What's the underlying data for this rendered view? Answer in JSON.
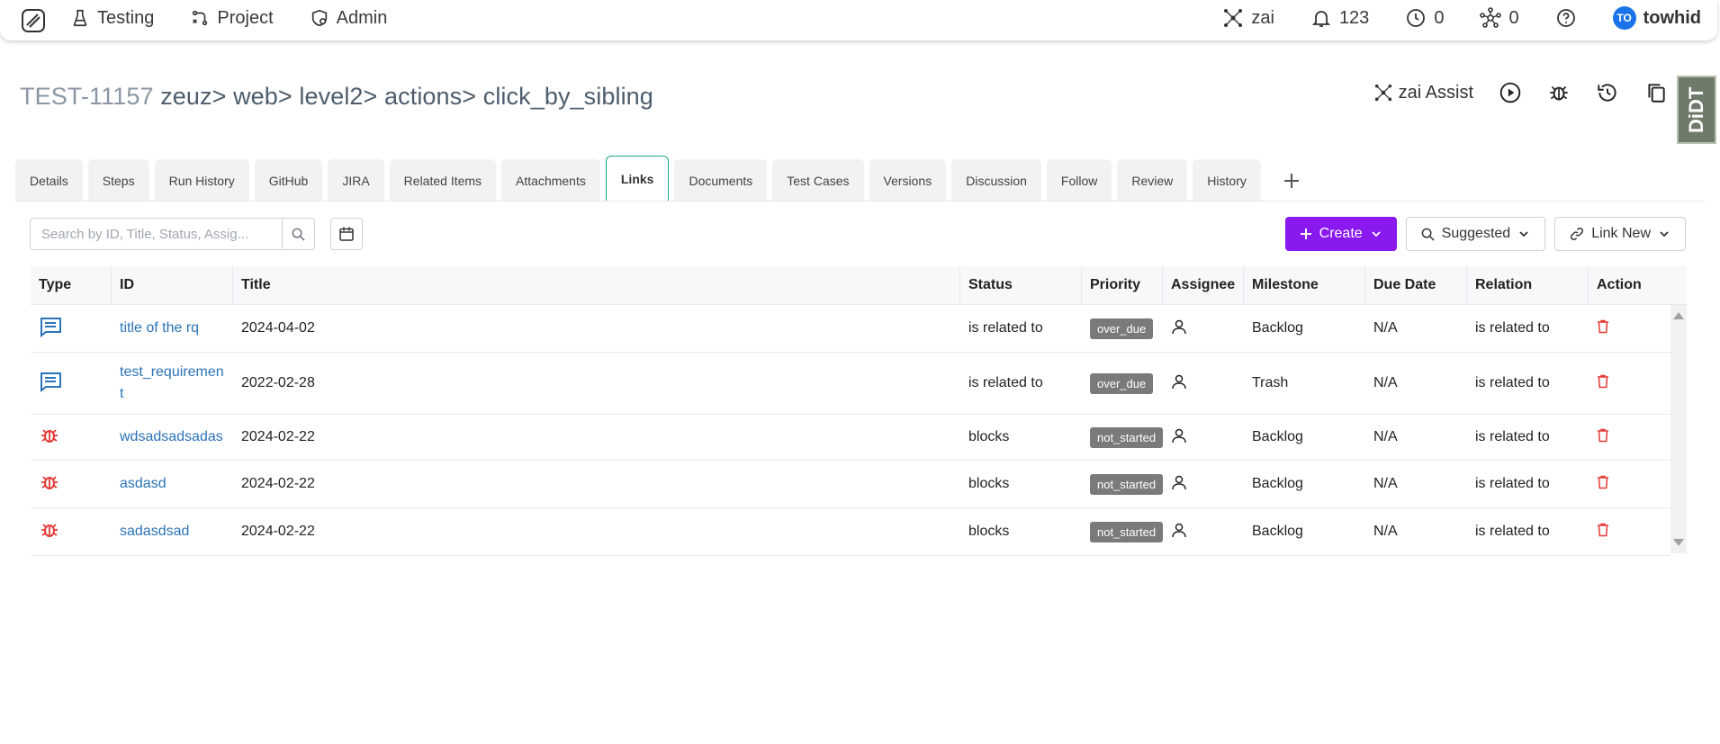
{
  "nav": {
    "items": [
      {
        "label": "Testing",
        "icon": "flask-icon"
      },
      {
        "label": "Project",
        "icon": "project-icon"
      },
      {
        "label": "Admin",
        "icon": "admin-icon"
      }
    ],
    "zai_label": "zai",
    "notifications_count": "123",
    "clock_count": "0",
    "network_count": "0",
    "avatar_initials": "TO",
    "username": "towhid"
  },
  "header": {
    "test_id": "TEST-11157",
    "path": "zeuz> web> level2> actions> click_by_sibling",
    "assist_label": "zai Assist",
    "side_badge": "DiDT"
  },
  "tabs": [
    "Details",
    "Steps",
    "Run History",
    "GitHub",
    "JIRA",
    "Related Items",
    "Attachments",
    "Links",
    "Documents",
    "Test Cases",
    "Versions",
    "Discussion",
    "Follow",
    "Review",
    "History"
  ],
  "active_tab": "Links",
  "toolbar": {
    "search_placeholder": "Search by ID, Title, Status, Assig...",
    "create_label": "Create",
    "suggested_label": "Suggested",
    "link_new_label": "Link New"
  },
  "table": {
    "columns": [
      "Type",
      "ID",
      "Title",
      "Status",
      "Priority",
      "Assignee",
      "Milestone",
      "Due Date",
      "Relation",
      "Action"
    ],
    "rows": [
      {
        "type": "requirement",
        "id": "title of the rq",
        "title": "2024-04-02",
        "status": "is related to",
        "priority": "over_due",
        "milestone": "Backlog",
        "due": "N/A",
        "relation": "is related to"
      },
      {
        "type": "requirement",
        "id": "test_requirement",
        "title": "2022-02-28",
        "status": "is related to",
        "priority": "over_due",
        "milestone": "Trash",
        "due": "N/A",
        "relation": "is related to"
      },
      {
        "type": "bug",
        "id": "wdsadsadsadas",
        "title": "2024-02-22",
        "status": "blocks",
        "priority": "not_started",
        "milestone": "Backlog",
        "due": "N/A",
        "relation": "is related to"
      },
      {
        "type": "bug",
        "id": "asdasd",
        "title": "2024-02-22",
        "status": "blocks",
        "priority": "not_started",
        "milestone": "Backlog",
        "due": "N/A",
        "relation": "is related to"
      },
      {
        "type": "bug",
        "id": "sadasdsad",
        "title": "2024-02-22",
        "status": "blocks",
        "priority": "not_started",
        "milestone": "Backlog",
        "due": "N/A",
        "relation": "is related to"
      }
    ]
  },
  "colors": {
    "accent": "#8a19f0",
    "tab_active_border": "#19a58a",
    "link": "#2b73b8",
    "delete": "#e53935",
    "bug": "#e53935",
    "requirement": "#2b73b8"
  }
}
